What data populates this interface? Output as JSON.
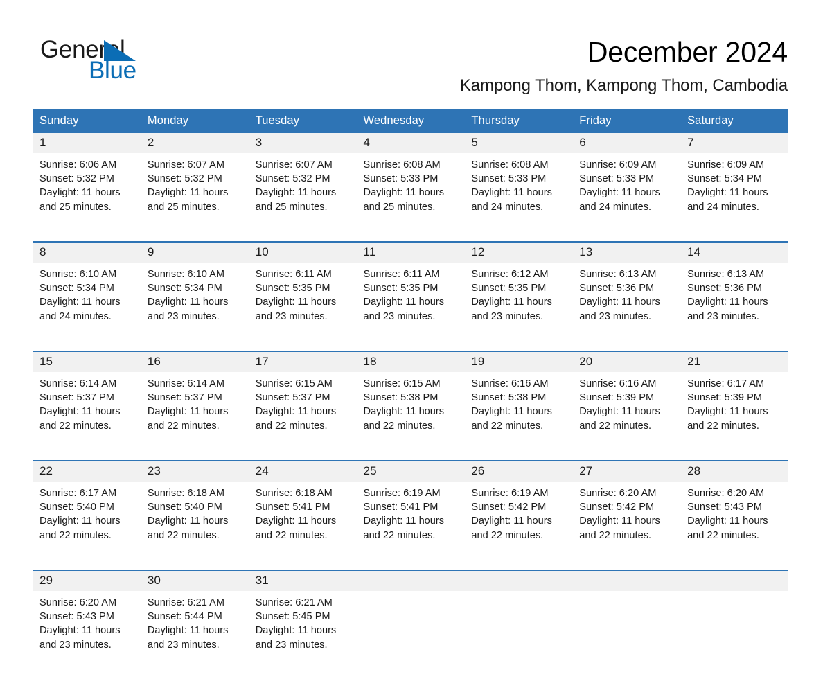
{
  "brand": {
    "name_part1": "General",
    "name_part2": "Blue",
    "triangle_icon": "triangle-icon",
    "accent_color": "#0b6db5"
  },
  "header": {
    "month_title": "December 2024",
    "location": "Kampong Thom, Kampong Thom, Cambodia"
  },
  "theme": {
    "header_blue": "#2e74b5",
    "date_strip_gray": "#f1f1f1",
    "text_color": "#1a1a1a"
  },
  "calendar": {
    "weekday_headers": [
      "Sunday",
      "Monday",
      "Tuesday",
      "Wednesday",
      "Thursday",
      "Friday",
      "Saturday"
    ],
    "weeks": [
      {
        "dates": [
          "1",
          "2",
          "3",
          "4",
          "5",
          "6",
          "7"
        ],
        "cells": [
          {
            "sunrise": "Sunrise: 6:06 AM",
            "sunset": "Sunset: 5:32 PM",
            "daylight_line1": "Daylight: 11 hours",
            "daylight_line2": "and 25 minutes."
          },
          {
            "sunrise": "Sunrise: 6:07 AM",
            "sunset": "Sunset: 5:32 PM",
            "daylight_line1": "Daylight: 11 hours",
            "daylight_line2": "and 25 minutes."
          },
          {
            "sunrise": "Sunrise: 6:07 AM",
            "sunset": "Sunset: 5:32 PM",
            "daylight_line1": "Daylight: 11 hours",
            "daylight_line2": "and 25 minutes."
          },
          {
            "sunrise": "Sunrise: 6:08 AM",
            "sunset": "Sunset: 5:33 PM",
            "daylight_line1": "Daylight: 11 hours",
            "daylight_line2": "and 25 minutes."
          },
          {
            "sunrise": "Sunrise: 6:08 AM",
            "sunset": "Sunset: 5:33 PM",
            "daylight_line1": "Daylight: 11 hours",
            "daylight_line2": "and 24 minutes."
          },
          {
            "sunrise": "Sunrise: 6:09 AM",
            "sunset": "Sunset: 5:33 PM",
            "daylight_line1": "Daylight: 11 hours",
            "daylight_line2": "and 24 minutes."
          },
          {
            "sunrise": "Sunrise: 6:09 AM",
            "sunset": "Sunset: 5:34 PM",
            "daylight_line1": "Daylight: 11 hours",
            "daylight_line2": "and 24 minutes."
          }
        ]
      },
      {
        "dates": [
          "8",
          "9",
          "10",
          "11",
          "12",
          "13",
          "14"
        ],
        "cells": [
          {
            "sunrise": "Sunrise: 6:10 AM",
            "sunset": "Sunset: 5:34 PM",
            "daylight_line1": "Daylight: 11 hours",
            "daylight_line2": "and 24 minutes."
          },
          {
            "sunrise": "Sunrise: 6:10 AM",
            "sunset": "Sunset: 5:34 PM",
            "daylight_line1": "Daylight: 11 hours",
            "daylight_line2": "and 23 minutes."
          },
          {
            "sunrise": "Sunrise: 6:11 AM",
            "sunset": "Sunset: 5:35 PM",
            "daylight_line1": "Daylight: 11 hours",
            "daylight_line2": "and 23 minutes."
          },
          {
            "sunrise": "Sunrise: 6:11 AM",
            "sunset": "Sunset: 5:35 PM",
            "daylight_line1": "Daylight: 11 hours",
            "daylight_line2": "and 23 minutes."
          },
          {
            "sunrise": "Sunrise: 6:12 AM",
            "sunset": "Sunset: 5:35 PM",
            "daylight_line1": "Daylight: 11 hours",
            "daylight_line2": "and 23 minutes."
          },
          {
            "sunrise": "Sunrise: 6:13 AM",
            "sunset": "Sunset: 5:36 PM",
            "daylight_line1": "Daylight: 11 hours",
            "daylight_line2": "and 23 minutes."
          },
          {
            "sunrise": "Sunrise: 6:13 AM",
            "sunset": "Sunset: 5:36 PM",
            "daylight_line1": "Daylight: 11 hours",
            "daylight_line2": "and 23 minutes."
          }
        ]
      },
      {
        "dates": [
          "15",
          "16",
          "17",
          "18",
          "19",
          "20",
          "21"
        ],
        "cells": [
          {
            "sunrise": "Sunrise: 6:14 AM",
            "sunset": "Sunset: 5:37 PM",
            "daylight_line1": "Daylight: 11 hours",
            "daylight_line2": "and 22 minutes."
          },
          {
            "sunrise": "Sunrise: 6:14 AM",
            "sunset": "Sunset: 5:37 PM",
            "daylight_line1": "Daylight: 11 hours",
            "daylight_line2": "and 22 minutes."
          },
          {
            "sunrise": "Sunrise: 6:15 AM",
            "sunset": "Sunset: 5:37 PM",
            "daylight_line1": "Daylight: 11 hours",
            "daylight_line2": "and 22 minutes."
          },
          {
            "sunrise": "Sunrise: 6:15 AM",
            "sunset": "Sunset: 5:38 PM",
            "daylight_line1": "Daylight: 11 hours",
            "daylight_line2": "and 22 minutes."
          },
          {
            "sunrise": "Sunrise: 6:16 AM",
            "sunset": "Sunset: 5:38 PM",
            "daylight_line1": "Daylight: 11 hours",
            "daylight_line2": "and 22 minutes."
          },
          {
            "sunrise": "Sunrise: 6:16 AM",
            "sunset": "Sunset: 5:39 PM",
            "daylight_line1": "Daylight: 11 hours",
            "daylight_line2": "and 22 minutes."
          },
          {
            "sunrise": "Sunrise: 6:17 AM",
            "sunset": "Sunset: 5:39 PM",
            "daylight_line1": "Daylight: 11 hours",
            "daylight_line2": "and 22 minutes."
          }
        ]
      },
      {
        "dates": [
          "22",
          "23",
          "24",
          "25",
          "26",
          "27",
          "28"
        ],
        "cells": [
          {
            "sunrise": "Sunrise: 6:17 AM",
            "sunset": "Sunset: 5:40 PM",
            "daylight_line1": "Daylight: 11 hours",
            "daylight_line2": "and 22 minutes."
          },
          {
            "sunrise": "Sunrise: 6:18 AM",
            "sunset": "Sunset: 5:40 PM",
            "daylight_line1": "Daylight: 11 hours",
            "daylight_line2": "and 22 minutes."
          },
          {
            "sunrise": "Sunrise: 6:18 AM",
            "sunset": "Sunset: 5:41 PM",
            "daylight_line1": "Daylight: 11 hours",
            "daylight_line2": "and 22 minutes."
          },
          {
            "sunrise": "Sunrise: 6:19 AM",
            "sunset": "Sunset: 5:41 PM",
            "daylight_line1": "Daylight: 11 hours",
            "daylight_line2": "and 22 minutes."
          },
          {
            "sunrise": "Sunrise: 6:19 AM",
            "sunset": "Sunset: 5:42 PM",
            "daylight_line1": "Daylight: 11 hours",
            "daylight_line2": "and 22 minutes."
          },
          {
            "sunrise": "Sunrise: 6:20 AM",
            "sunset": "Sunset: 5:42 PM",
            "daylight_line1": "Daylight: 11 hours",
            "daylight_line2": "and 22 minutes."
          },
          {
            "sunrise": "Sunrise: 6:20 AM",
            "sunset": "Sunset: 5:43 PM",
            "daylight_line1": "Daylight: 11 hours",
            "daylight_line2": "and 22 minutes."
          }
        ]
      },
      {
        "dates": [
          "29",
          "30",
          "31",
          "",
          "",
          "",
          ""
        ],
        "cells": [
          {
            "sunrise": "Sunrise: 6:20 AM",
            "sunset": "Sunset: 5:43 PM",
            "daylight_line1": "Daylight: 11 hours",
            "daylight_line2": "and 23 minutes."
          },
          {
            "sunrise": "Sunrise: 6:21 AM",
            "sunset": "Sunset: 5:44 PM",
            "daylight_line1": "Daylight: 11 hours",
            "daylight_line2": "and 23 minutes."
          },
          {
            "sunrise": "Sunrise: 6:21 AM",
            "sunset": "Sunset: 5:45 PM",
            "daylight_line1": "Daylight: 11 hours",
            "daylight_line2": "and 23 minutes."
          },
          {
            "sunrise": "",
            "sunset": "",
            "daylight_line1": "",
            "daylight_line2": ""
          },
          {
            "sunrise": "",
            "sunset": "",
            "daylight_line1": "",
            "daylight_line2": ""
          },
          {
            "sunrise": "",
            "sunset": "",
            "daylight_line1": "",
            "daylight_line2": ""
          },
          {
            "sunrise": "",
            "sunset": "",
            "daylight_line1": "",
            "daylight_line2": ""
          }
        ]
      }
    ]
  }
}
